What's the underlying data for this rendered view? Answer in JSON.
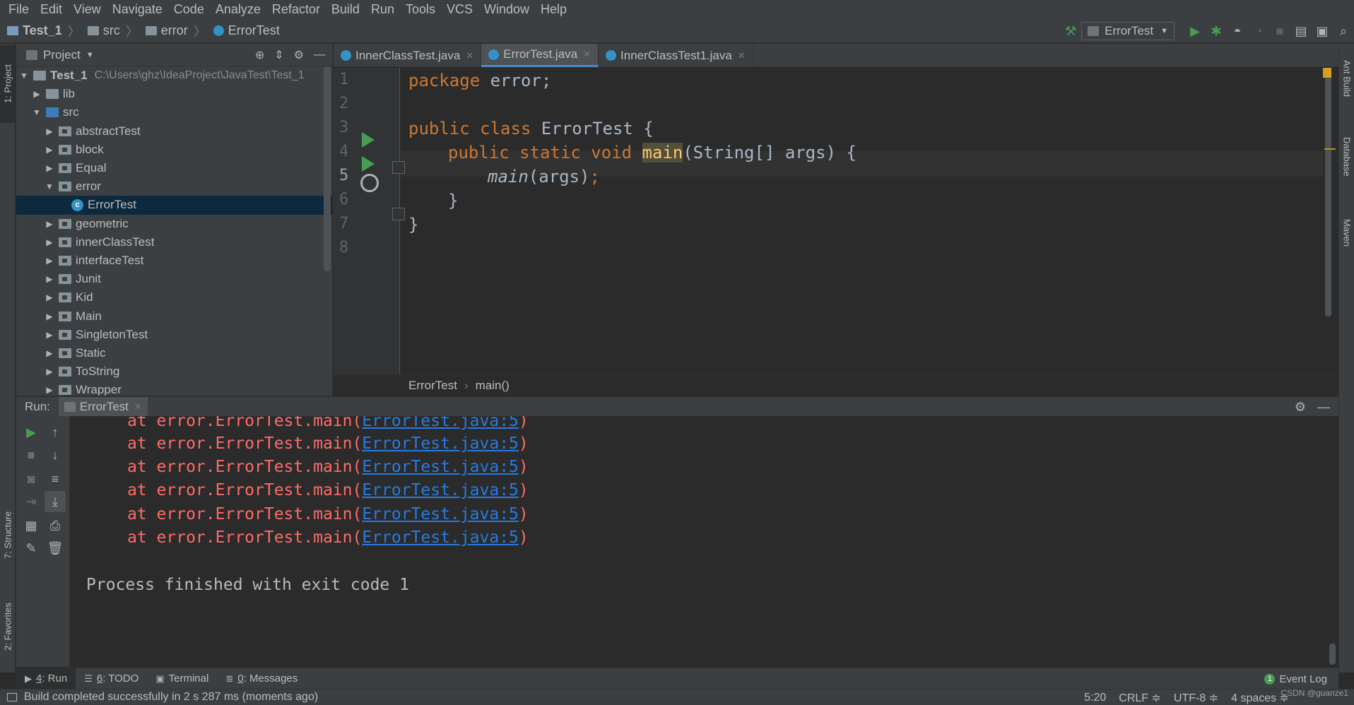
{
  "menu": [
    "File",
    "Edit",
    "View",
    "Navigate",
    "Code",
    "Analyze",
    "Refactor",
    "Build",
    "Run",
    "Tools",
    "VCS",
    "Window",
    "Help"
  ],
  "breadcrumb": {
    "project": "Test_1",
    "src": "src",
    "package": "error",
    "class": "ErrorTest"
  },
  "run_config": "ErrorTest",
  "left_tabs": {
    "project": "1: Project",
    "structure": "7: Structure",
    "favorites": "2: Favorites"
  },
  "right_tabs": {
    "ant": "Ant Build",
    "database": "Database",
    "maven": "Maven"
  },
  "project_panel": {
    "title": "Project",
    "root_name": "Test_1",
    "root_path": "C:\\Users\\ghz\\IdeaProject\\JavaTest\\Test_1",
    "items": [
      {
        "label": "lib",
        "arrow": "▶"
      },
      {
        "label": "src",
        "arrow": "▼"
      },
      {
        "label": "abstractTest",
        "arrow": "▶"
      },
      {
        "label": "block",
        "arrow": "▶"
      },
      {
        "label": "Equal",
        "arrow": "▶"
      },
      {
        "label": "error",
        "arrow": "▼"
      },
      {
        "label": "ErrorTest",
        "arrow": ""
      },
      {
        "label": "geometric",
        "arrow": "▶"
      },
      {
        "label": "innerClassTest",
        "arrow": "▶"
      },
      {
        "label": "interfaceTest",
        "arrow": "▶"
      },
      {
        "label": "Junit",
        "arrow": "▶"
      },
      {
        "label": "Kid",
        "arrow": "▶"
      },
      {
        "label": "Main",
        "arrow": "▶"
      },
      {
        "label": "SingletonTest",
        "arrow": "▶"
      },
      {
        "label": "Static",
        "arrow": "▶"
      },
      {
        "label": "ToString",
        "arrow": "▶"
      },
      {
        "label": "Wrapper",
        "arrow": "▶"
      }
    ]
  },
  "editor_tabs": [
    "InnerClassTest.java",
    "ErrorTest.java",
    "InnerClassTest1.java"
  ],
  "editor": {
    "line_numbers": [
      "1",
      "2",
      "3",
      "4",
      "5",
      "6",
      "7",
      "8"
    ],
    "l1_kw": "package",
    "l1_rest": " error;",
    "l3_kw": "public class",
    "l3_rest": " ErrorTest {",
    "l4_kw": "public static void",
    "l4_fn": "main",
    "l4_rest": "(String[] args) {",
    "l5_call": "main",
    "l5_rest": "(args)",
    "l5_semi": ";",
    "l6": "}",
    "l7": "}",
    "crumbs": [
      "ErrorTest",
      "main()"
    ]
  },
  "run_panel": {
    "label": "Run:",
    "tab": "ErrorTest",
    "trace_prefix": "at error.ErrorTest.main(",
    "trace_link": "ErrorTest.java:5",
    "trace_suffix": ")",
    "finished": "Process finished with exit code 1"
  },
  "bottom_tabs": [
    {
      "prefix": "4",
      "label": ": Run"
    },
    {
      "prefix": "6",
      "label": ": TODO"
    },
    {
      "prefix": "",
      "label": "Terminal"
    },
    {
      "prefix": "0",
      "label": ": Messages"
    }
  ],
  "event_log": {
    "count": "1",
    "label": "Event Log"
  },
  "status": {
    "message": "Build completed successfully in 2 s 287 ms (moments ago)",
    "position": "5:20",
    "line_sep": "CRLF ≑",
    "encoding": "UTF-8 ≑",
    "indent": "4 spaces ≑"
  },
  "watermark": "CSDN @guanze1"
}
